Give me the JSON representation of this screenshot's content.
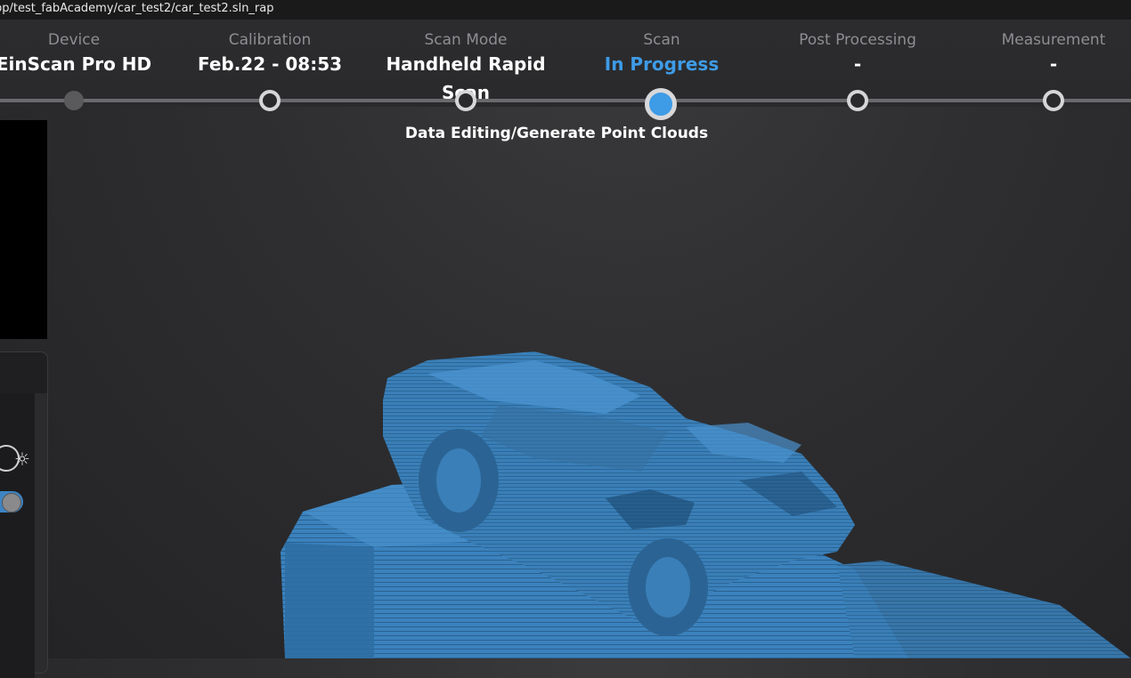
{
  "window": {
    "title": "pp/test_fabAcademy/car_test2/car_test2.sln_rap"
  },
  "steps": [
    {
      "label": "Device",
      "value": "EinScan Pro HD"
    },
    {
      "label": "Calibration",
      "value": "Feb.22 - 08:53"
    },
    {
      "label": "Scan Mode",
      "value": "Handheld Rapid Scan"
    },
    {
      "label": "Scan",
      "value": "In Progress"
    },
    {
      "label": "Post Processing",
      "value": "-"
    },
    {
      "label": "Measurement",
      "value": "-"
    }
  ],
  "substep": "Data Editing/Generate Point Clouds",
  "left_panel": {
    "brightness_icon": "sun-icon",
    "toggle_on": true
  },
  "colors": {
    "accent": "#3e9be6",
    "pointcloud": "#3a7fb8"
  },
  "icons": [
    "sun-icon"
  ]
}
